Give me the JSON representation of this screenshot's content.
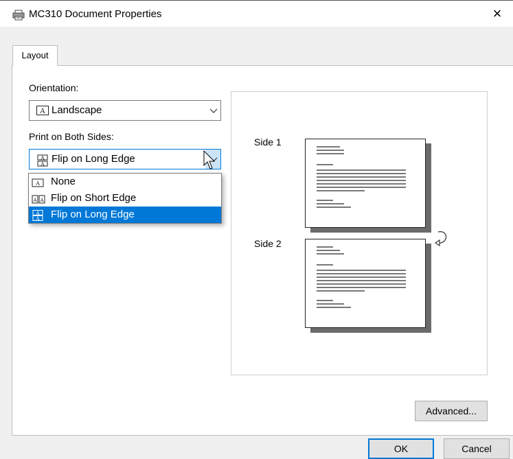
{
  "window": {
    "title": "MC310 Document Properties",
    "close": "×"
  },
  "tabs": [
    {
      "label": "Layout"
    }
  ],
  "orientation": {
    "label": "Orientation:",
    "value": "Landscape"
  },
  "duplex": {
    "label": "Print on Both Sides:",
    "value": "Flip on Long Edge",
    "options": [
      {
        "label": "None"
      },
      {
        "label": "Flip on Short Edge"
      },
      {
        "label": "Flip on Long Edge",
        "selected": true
      }
    ]
  },
  "preview": {
    "side1": "Side 1",
    "side2": "Side 2"
  },
  "buttons": {
    "advanced": "Advanced...",
    "ok": "OK",
    "cancel": "Cancel"
  },
  "colors": {
    "accent": "#0078d7",
    "hover": "#cce4f7"
  }
}
